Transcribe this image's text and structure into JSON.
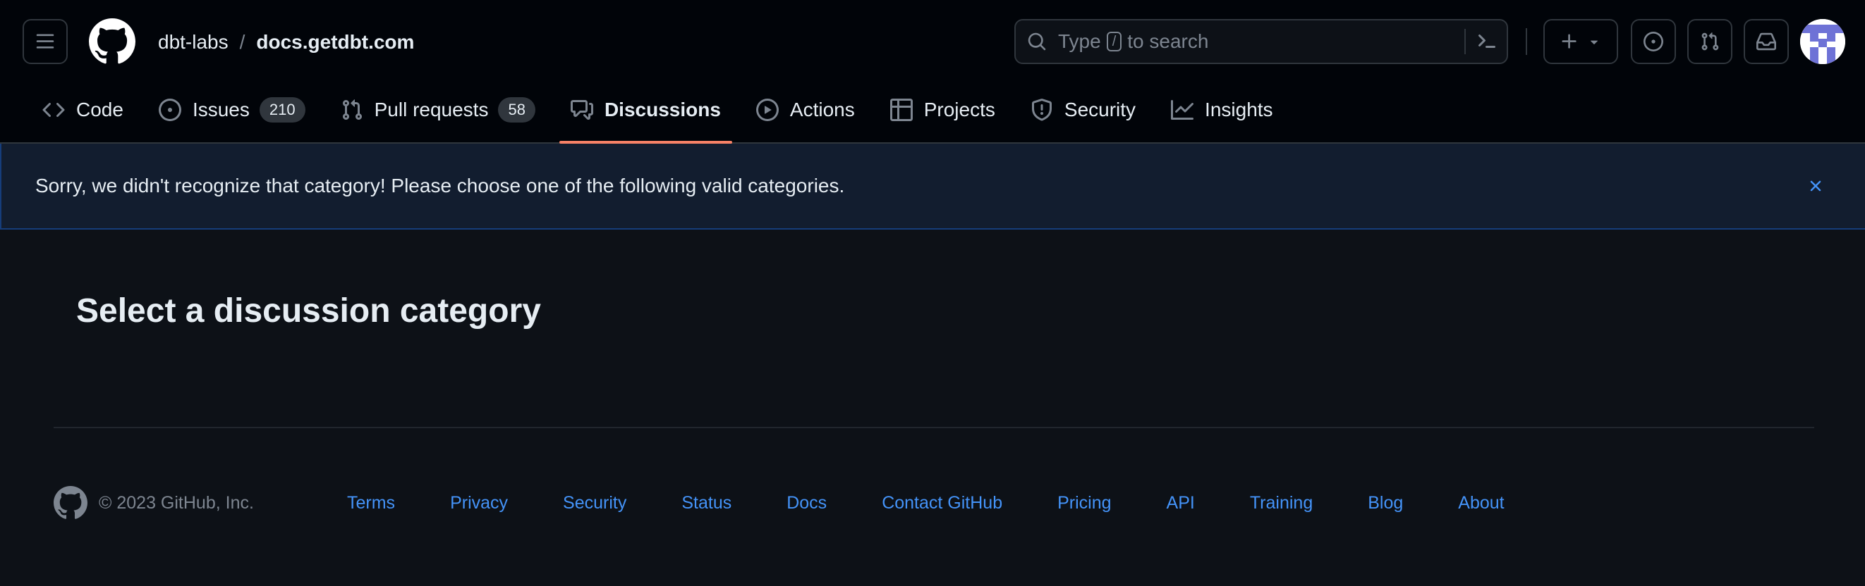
{
  "header": {
    "owner": "dbt-labs",
    "separator": "/",
    "repo": "docs.getdbt.com",
    "search_prefix": "Type",
    "search_key": "/",
    "search_suffix": "to search"
  },
  "tabs": [
    {
      "label": "Code",
      "icon": "code-icon"
    },
    {
      "label": "Issues",
      "icon": "issue-opened-icon",
      "count": "210"
    },
    {
      "label": "Pull requests",
      "icon": "git-pull-request-icon",
      "count": "58"
    },
    {
      "label": "Discussions",
      "icon": "comment-discussion-icon",
      "active": true
    },
    {
      "label": "Actions",
      "icon": "play-icon"
    },
    {
      "label": "Projects",
      "icon": "table-icon"
    },
    {
      "label": "Security",
      "icon": "shield-icon"
    },
    {
      "label": "Insights",
      "icon": "graph-icon"
    }
  ],
  "flash": {
    "message": "Sorry, we didn't recognize that category! Please choose one of the following valid categories."
  },
  "main": {
    "title": "Select a discussion category"
  },
  "footer": {
    "copyright": "© 2023 GitHub, Inc.",
    "links": [
      "Terms",
      "Privacy",
      "Security",
      "Status",
      "Docs",
      "Contact GitHub",
      "Pricing",
      "API",
      "Training",
      "Blog",
      "About"
    ]
  },
  "colors": {
    "header_bg": "#010409",
    "page_bg": "#0d1117",
    "accent_underline": "#f78166",
    "link": "#4493f8",
    "flash_bg": "#121d2f"
  }
}
